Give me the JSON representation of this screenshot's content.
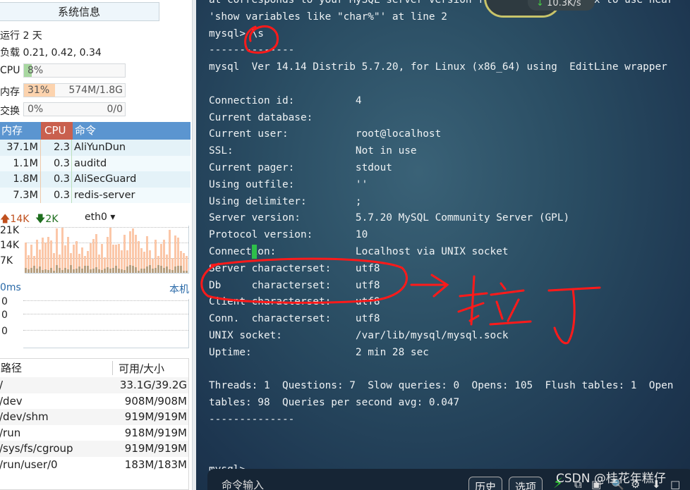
{
  "sidebar": {
    "title": "系统信息",
    "uptime": "运行 2 天",
    "load": "负载 0.21, 0.42, 0.34",
    "cpu": {
      "label": "CPU",
      "percent": "8%",
      "fill": 8
    },
    "mem": {
      "label": "内存",
      "percent": "31%",
      "value": "574M/1.8G",
      "fill": 31
    },
    "swap": {
      "label": "交换",
      "percent": "0%",
      "value": "0/0",
      "fill": 0
    },
    "process_headers": [
      "内存",
      "CPU",
      "命令"
    ],
    "processes": [
      {
        "mem": "37.1M",
        "cpu": "2.3",
        "cmd": "AliYunDun"
      },
      {
        "mem": "1.1M",
        "cpu": "0.3",
        "cmd": "auditd"
      },
      {
        "mem": "1.8M",
        "cpu": "0.3",
        "cmd": "AliSecGuard"
      },
      {
        "mem": "7.3M",
        "cpu": "0.3",
        "cmd": "redis-server"
      }
    ],
    "net": {
      "up": "14K",
      "down": "2K",
      "iface": "eth0",
      "ticks": [
        "21K",
        "14K",
        "7K"
      ]
    },
    "latency": {
      "label": "0ms",
      "host": "本机",
      "ticks": [
        "0",
        "0",
        "0"
      ]
    },
    "disk_headers": [
      "路径",
      "可用/大小"
    ],
    "disks": [
      {
        "path": "/",
        "size": "33.1G/39.2G"
      },
      {
        "path": "/dev",
        "size": "908M/908M"
      },
      {
        "path": "/dev/shm",
        "size": "919M/919M"
      },
      {
        "path": "/run",
        "size": "918M/919M"
      },
      {
        "path": "/sys/fs/cgroup",
        "size": "919M/919M"
      },
      {
        "path": "/run/user/0",
        "size": "183M/183M"
      }
    ]
  },
  "terminal": {
    "text": "at corresponds to your MySQL server version for the right syntax to use near\n'show variables like \"char%\"' at line 2\nmysql> \\s\n--------------\nmysql  Ver 14.14 Distrib 5.7.20, for Linux (x86_64) using  EditLine wrapper\n\nConnection id:          4\nCurrent database:\nCurrent user:           root@localhost\nSSL:                    Not in use\nCurrent pager:          stdout\nUsing outfile:          ''\nUsing delimiter:        ;\nServer version:         5.7.20 MySQL Community Server (GPL)\nProtocol version:       10\nConnection:             Localhost via UNIX socket\nServer characterset:    utf8\nDb     characterset:    utf8\nClient characterset:    utf8\nConn.  characterset:    utf8\nUNIX socket:            /var/lib/mysql/mysql.sock\nUptime:                 2 min 28 sec\n\nThreads: 1  Questions: 7  Slow queries: 0  Opens: 105  Flush tables: 1  Open\ntables: 98  Queries per second avg: 0.047\n--------------\n\n\nmysql>",
    "speed": "10.3K/s",
    "cmd_label": "命令输入",
    "history": "历史",
    "options": "选项"
  },
  "annotation": {
    "handwriting": "拉丁",
    "color": "#ff1a1a"
  },
  "watermark": "CSDN @桂花年糕仔"
}
